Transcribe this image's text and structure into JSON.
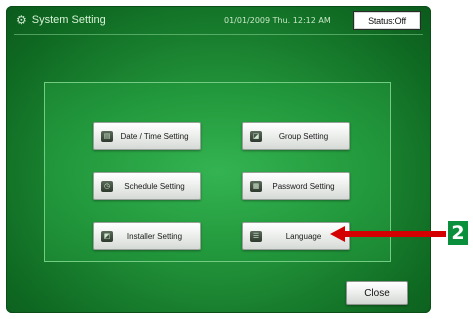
{
  "header": {
    "title": "System Setting",
    "datetime": "01/01/2009 Thu. 12:12 AM",
    "status": "Status:Off"
  },
  "buttons": [
    {
      "label": "Date / Time Setting",
      "icon": "calendar-icon"
    },
    {
      "label": "Group Setting",
      "icon": "group-icon"
    },
    {
      "label": "Schedule Setting",
      "icon": "schedule-icon"
    },
    {
      "label": "Password Setting",
      "icon": "keyboard-icon"
    },
    {
      "label": "Installer Setting",
      "icon": "installer-icon"
    },
    {
      "label": "Language",
      "icon": "language-icon"
    }
  ],
  "close_label": "Close",
  "annotation": {
    "number": "2",
    "color": "#d40000",
    "badge_color": "#0a8f3c"
  }
}
